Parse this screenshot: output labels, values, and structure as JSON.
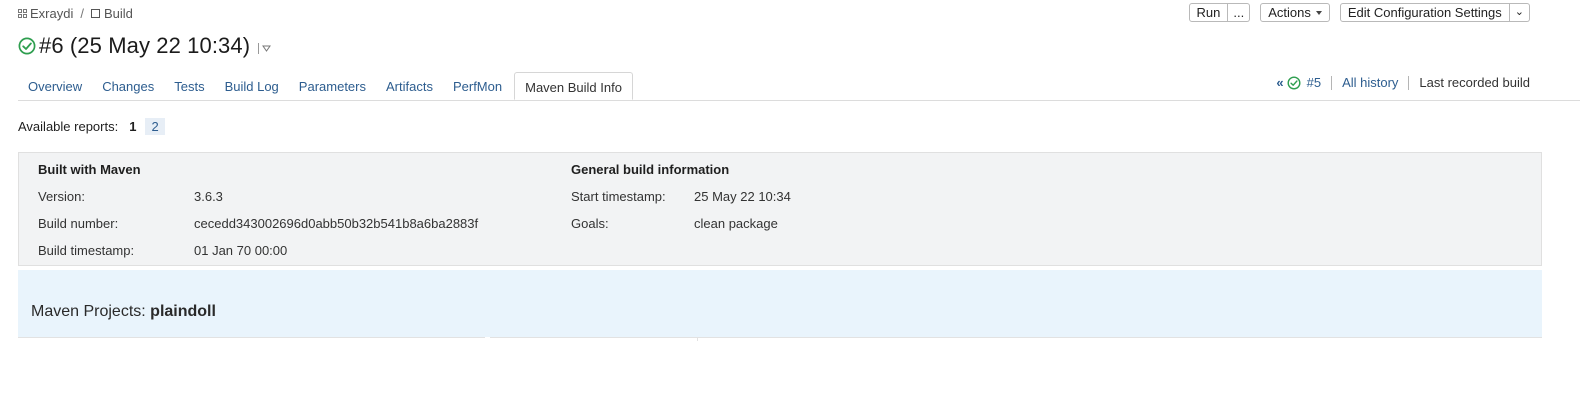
{
  "breadcrumb": {
    "project": "Exraydi",
    "separator": "/",
    "build_config": "Build"
  },
  "top_actions": {
    "run": "Run",
    "more": "...",
    "actions": "Actions",
    "edit": "Edit Configuration Settings"
  },
  "build": {
    "title": "#6 (25 May 22 10:34)"
  },
  "tabs": [
    {
      "label": "Overview"
    },
    {
      "label": "Changes"
    },
    {
      "label": "Tests"
    },
    {
      "label": "Build Log"
    },
    {
      "label": "Parameters"
    },
    {
      "label": "Artifacts"
    },
    {
      "label": "PerfMon"
    },
    {
      "label": "Maven Build Info"
    }
  ],
  "active_tab": "Maven Build Info",
  "history": {
    "prev_build": "#5",
    "all_history": "All history",
    "last_recorded": "Last recorded build"
  },
  "reports": {
    "label": "Available reports:",
    "current": "1",
    "other": "2"
  },
  "built_with_maven": {
    "heading": "Built with Maven",
    "rows": [
      {
        "key": "Version:",
        "value": "3.6.3"
      },
      {
        "key": "Build number:",
        "value": "cecedd343002696d0abb50b32b541b8a6ba2883f"
      },
      {
        "key": "Build timestamp:",
        "value": "01 Jan 70 00:00"
      }
    ]
  },
  "general_info": {
    "heading": "General build information",
    "rows": [
      {
        "key": "Start timestamp:",
        "value": "25 May 22 10:34"
      },
      {
        "key": "Goals:",
        "value": "clean package"
      }
    ]
  },
  "maven_projects": {
    "label": "Maven Projects:",
    "name": "plaindoll"
  },
  "colors": {
    "link": "#2d5d8f",
    "success": "#2e9e4f",
    "info_bg": "#f2f3f4",
    "projects_bg": "#e9f4fc"
  }
}
